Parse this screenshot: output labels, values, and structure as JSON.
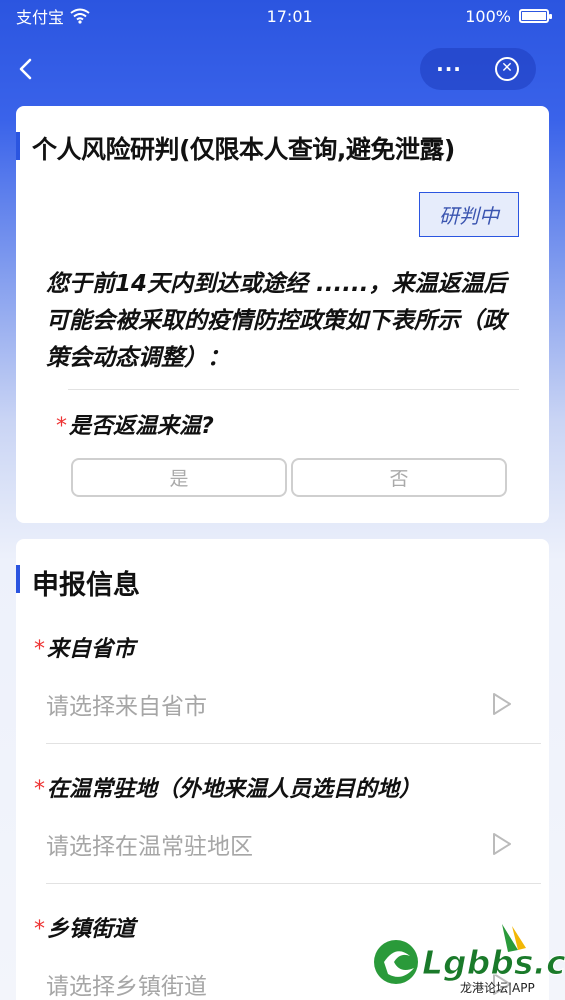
{
  "status_bar": {
    "carrier": "支付宝",
    "time": "17:01",
    "battery": "100%"
  },
  "nav": {
    "more_label": "···",
    "close_label": "✕"
  },
  "risk_card": {
    "title": "个人风险研判(仅限本人查询,避免泄露)",
    "status": "研判中",
    "notice": "您于前14天内到达或途经 ......，来温返温后可能会被采取的疫情防控政策如下表所示（政策会动态调整）：",
    "question": "是否返温来温?",
    "required_mark": "*",
    "options": [
      "是",
      "否"
    ]
  },
  "report_card": {
    "title": "申报信息",
    "fields": [
      {
        "label": "来自省市",
        "placeholder": "请选择来自省市"
      },
      {
        "label": "在温常驻地（外地来温人员选目的地）",
        "placeholder": "请选择在温常驻地区"
      },
      {
        "label": "乡镇街道",
        "placeholder": "请选择乡镇街道"
      }
    ]
  },
  "watermark": {
    "brand": "Lgbbs.cn",
    "sub": "龙港论坛|APP"
  },
  "colors": {
    "accent": "#2b55e0",
    "required": "#e33333",
    "placeholder": "#a6a6a6"
  }
}
